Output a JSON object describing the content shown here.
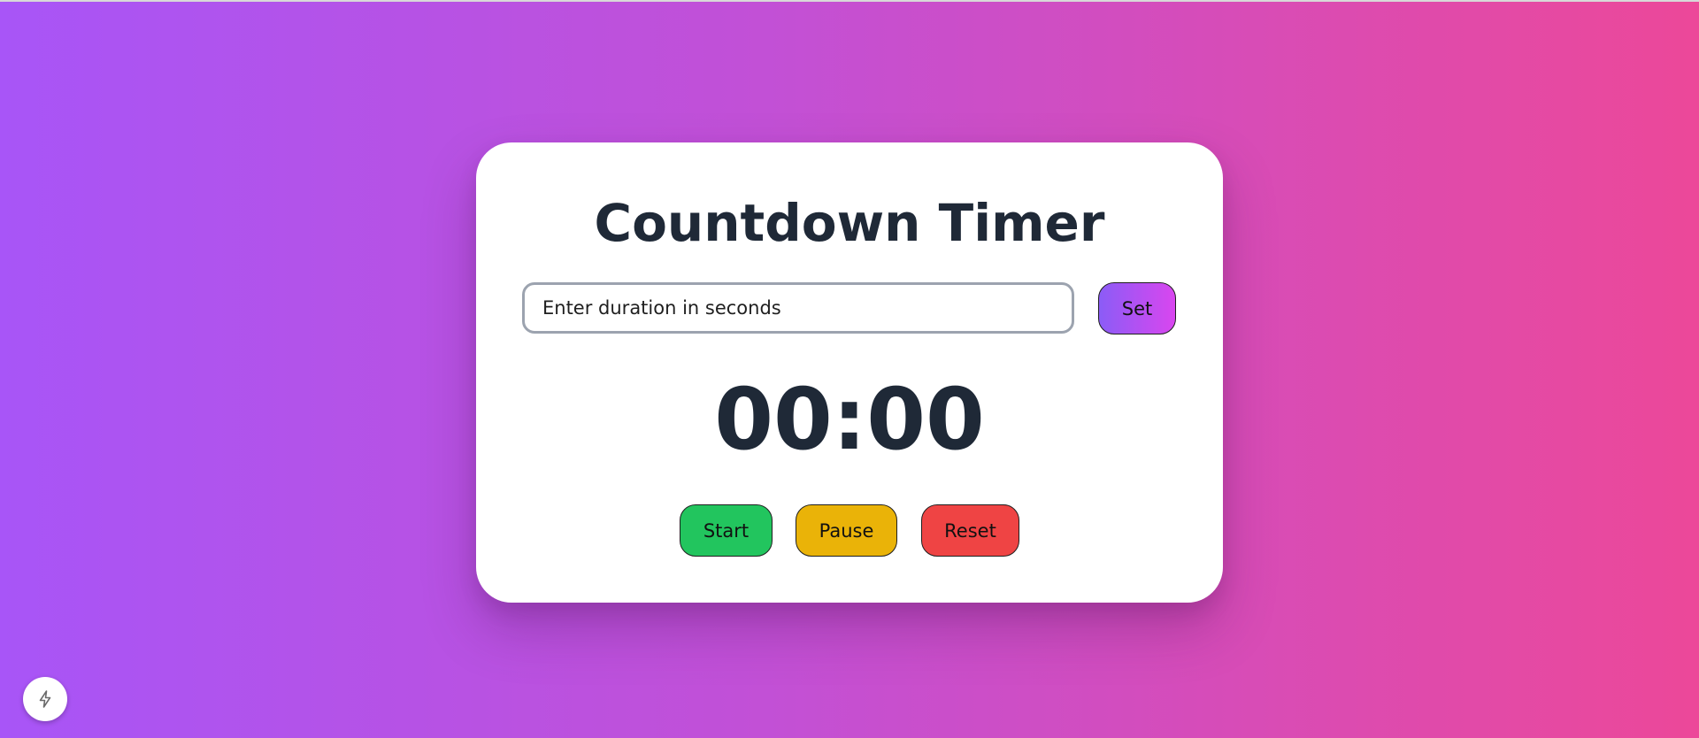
{
  "card": {
    "title": "Countdown Timer",
    "duration_input": {
      "value": "",
      "placeholder": "Enter duration in seconds"
    },
    "set_label": "Set",
    "display": "00:00",
    "controls": {
      "start_label": "Start",
      "pause_label": "Pause",
      "reset_label": "Reset"
    }
  },
  "floating_button": {
    "icon": "lightning-icon"
  },
  "colors": {
    "background_start": "#a855f7",
    "background_end": "#ec4899",
    "card": "#ffffff",
    "text_dark": "#1f2937",
    "set_gradient_start": "#8b5cf6",
    "set_gradient_end": "#d946ef",
    "start": "#22c55e",
    "pause": "#eab308",
    "reset": "#ef4444"
  }
}
